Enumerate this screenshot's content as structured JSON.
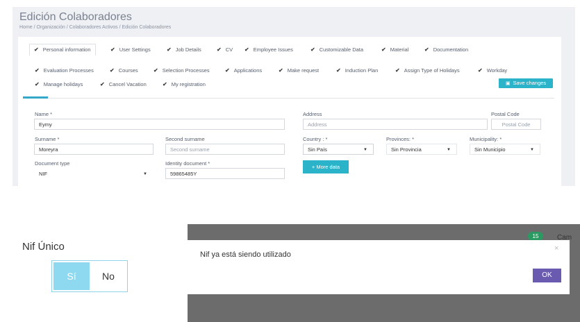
{
  "header": {
    "title": "Edición Colaboradores",
    "breadcrumb": "Home  /  Organización  /  Colaboradores Activos  /  Edición Colaboradores"
  },
  "tabs": [
    "Personal information",
    "User Settings",
    "Job Details",
    "CV",
    "Employee Issues",
    "Customizable Data",
    "Material",
    "Documentation",
    "Evaluation Processes",
    "Courses",
    "Selection Processes",
    "Applications",
    "Make request",
    "Induction Plan",
    "Assign Type of Holidays",
    "Workday",
    "Manage holidays",
    "Cancel Vacation",
    "My registration"
  ],
  "active_tab": "Personal information",
  "save_button": "Save changes",
  "form": {
    "name_label": "Name *",
    "name_value": "Eymy",
    "address_label": "Address",
    "address_placeholder": "Address",
    "postal_label": "Postal Code",
    "postal_placeholder": "Postal Code",
    "surname_label": "Surname *",
    "surname_value": "Moreyra",
    "second_surname_label": "Second surname",
    "second_surname_placeholder": "Second surname",
    "country_label": "Country : *",
    "country_value": "Sin País",
    "provinces_label": "Provinces: *",
    "provinces_value": "Sin Provincia",
    "municipality_label": "Municipality: *",
    "municipality_value": "Sin Municipio",
    "doc_type_label": "Document type",
    "doc_type_value": "NIF",
    "identity_label": "Identity document *",
    "identity_value": "59865485Y",
    "more_data_button": "+ More data"
  },
  "nif_unico": {
    "title": "Nif Único",
    "yes": "Sí",
    "no": "No",
    "selected": "Sí"
  },
  "background_peek": {
    "badge": "15",
    "text": "Cam"
  },
  "modal": {
    "message": "Nif ya está siendo utilizado",
    "close": "×",
    "ok": "OK"
  },
  "colors": {
    "accent": "#2ab3c9",
    "ok_button": "#6a5bb0",
    "toggle_selected": "#8ed8f0"
  }
}
